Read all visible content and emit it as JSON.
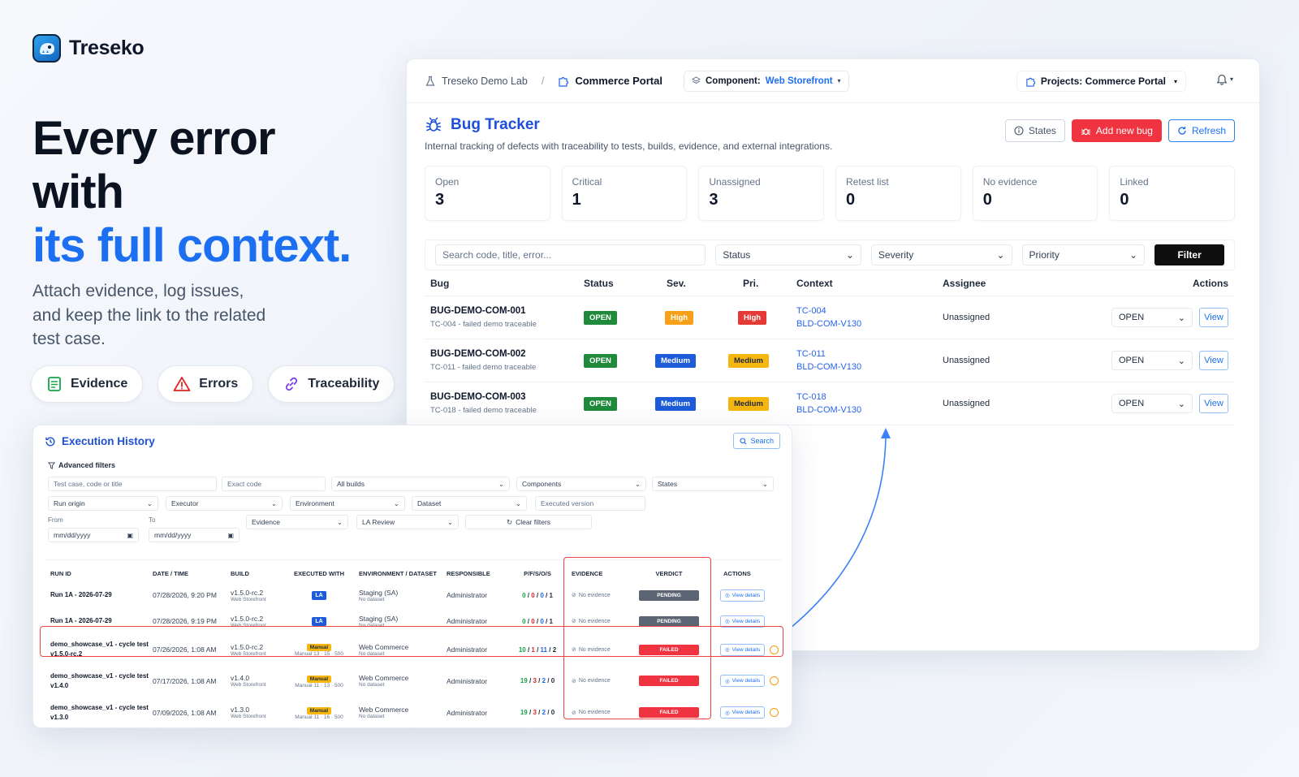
{
  "brand": {
    "name": "Treseko"
  },
  "hero": {
    "line1": "Every error",
    "line2": "with",
    "line3": "its full context.",
    "subtitle": "Attach evidence, log issues, and keep the link to the related test case."
  },
  "chips": [
    {
      "label": "Evidence",
      "icon": "document-icon",
      "color": "#16a34a"
    },
    {
      "label": "Errors",
      "icon": "warning-icon",
      "color": "#dc2626"
    },
    {
      "label": "Traceability",
      "icon": "link-icon",
      "color": "#7c3aed"
    }
  ],
  "colors": {
    "accent": "#1d6ff2",
    "danger": "#ef3340",
    "success": "#1f8a3b",
    "warning": "#f5b70f"
  },
  "bug_tracker": {
    "breadcrumb": {
      "lab": "Treseko Demo Lab",
      "sep": "/",
      "portal": "Commerce Portal"
    },
    "component_label": "Component:",
    "component_value": "Web Storefront",
    "projects_label": "Projects: Commerce Portal",
    "title": "Bug Tracker",
    "description": "Internal tracking of defects with traceability to tests, builds, evidence, and external integrations.",
    "actions": {
      "states": "States",
      "add": "Add new bug",
      "refresh": "Refresh"
    },
    "stats": [
      {
        "label": "Open",
        "value": "3"
      },
      {
        "label": "Critical",
        "value": "1"
      },
      {
        "label": "Unassigned",
        "value": "3"
      },
      {
        "label": "Retest list",
        "value": "0"
      },
      {
        "label": "No evidence",
        "value": "0"
      },
      {
        "label": "Linked",
        "value": "0"
      }
    ],
    "filters": {
      "search_placeholder": "Search code, title, error...",
      "status": "Status",
      "severity": "Severity",
      "priority": "Priority",
      "button": "Filter"
    },
    "columns": {
      "bug": "Bug",
      "status": "Status",
      "sev": "Sev.",
      "pri": "Pri.",
      "context": "Context",
      "assignee": "Assignee",
      "actions": "Actions"
    },
    "rows": [
      {
        "code": "BUG-DEMO-COM-001",
        "sub": "TC-004 - failed demo traceable",
        "status": "OPEN",
        "sev": "High",
        "pri": "High",
        "tc": "TC-004",
        "build": "BLD-COM-V130",
        "assignee": "Unassigned",
        "state": "OPEN",
        "view": "View"
      },
      {
        "code": "BUG-DEMO-COM-002",
        "sub": "TC-011 - failed demo traceable",
        "status": "OPEN",
        "sev": "Medium",
        "pri": "Medium",
        "tc": "TC-011",
        "build": "BLD-COM-V130",
        "assignee": "Unassigned",
        "state": "OPEN",
        "view": "View"
      },
      {
        "code": "BUG-DEMO-COM-003",
        "sub": "TC-018 - failed demo traceable",
        "status": "OPEN",
        "sev": "Medium",
        "pri": "Medium",
        "tc": "TC-018",
        "build": "BLD-COM-V130",
        "assignee": "Unassigned",
        "state": "OPEN",
        "view": "View"
      }
    ]
  },
  "execution_history": {
    "title": "Execution History",
    "search": "Search",
    "advanced": "Advanced filters",
    "filters": {
      "testcase": "Test case, code or title",
      "exact_code": "Exact code",
      "builds": "All builds",
      "components": "Components",
      "states": "States",
      "run_origin": "Run origin",
      "executor": "Executor",
      "environment": "Environment",
      "dataset": "Dataset",
      "executed_version": "Executed version",
      "from_label": "From",
      "to_label": "To",
      "from": "mm/dd/yyyy",
      "to": "mm/dd/yyyy",
      "evidence": "Evidence",
      "la_review": "LA Review",
      "clear": "Clear filters"
    },
    "columns": {
      "run": "RUN ID",
      "date": "DATE / TIME",
      "build": "BUILD",
      "exec": "EXECUTED WITH",
      "env": "ENVIRONMENT / DATASET",
      "resp": "RESPONSIBLE",
      "pfso": "P/F/S/O/S",
      "evi": "EVIDENCE",
      "verdict": "VERDICT",
      "actions": "ACTIONS"
    },
    "rows": [
      {
        "run1": "Run 1A - 2026-07-29",
        "run2": "",
        "date": "07/28/2026, 9:20 PM",
        "build": "v1.5.0-rc.2",
        "build_sub": "Web Storefront",
        "exec": "LA",
        "exec_sub": "",
        "env": "Staging (SA)",
        "env_sub": "No dataset",
        "resp": "Administrator",
        "p": "0",
        "f": "0",
        "s": "0",
        "o": "1",
        "evi": "No evidence",
        "verdict": "PENDING",
        "action": "View details"
      },
      {
        "run1": "Run 1A - 2026-07-29",
        "run2": "",
        "date": "07/28/2026, 9:19 PM",
        "build": "v1.5.0-rc.2",
        "build_sub": "Web Storefront",
        "exec": "LA",
        "exec_sub": "",
        "env": "Staging (SA)",
        "env_sub": "No dataset",
        "resp": "Administrator",
        "p": "0",
        "f": "0",
        "s": "0",
        "o": "1",
        "evi": "No evidence",
        "verdict": "PENDING",
        "action": "View details"
      },
      {
        "run1": "demo_showcase_v1 - cycle test",
        "run2": "v1.5.0-rc.2",
        "date": "07/26/2026, 1:08 AM",
        "build": "v1.5.0-rc.2",
        "build_sub": "Web Storefront",
        "exec": "Manual",
        "exec_sub": "Manual 13 · 15 · 500",
        "env": "Web Commerce",
        "env_sub": "No dataset",
        "resp": "Administrator",
        "p": "10",
        "f": "1",
        "s": "11",
        "o": "2",
        "evi": "No evidence",
        "verdict": "FAILED",
        "action": "View details"
      },
      {
        "run1": "demo_showcase_v1 - cycle test",
        "run2": "v1.4.0",
        "date": "07/17/2026, 1:08 AM",
        "build": "v1.4.0",
        "build_sub": "Web Storefront",
        "exec": "Manual",
        "exec_sub": "Manual 11 · 13 · 500",
        "env": "Web Commerce",
        "env_sub": "No dataset",
        "resp": "Administrator",
        "p": "19",
        "f": "3",
        "s": "2",
        "o": "0",
        "evi": "No evidence",
        "verdict": "FAILED",
        "action": "View details"
      },
      {
        "run1": "demo_showcase_v1 - cycle test",
        "run2": "v1.3.0",
        "date": "07/09/2026, 1:08 AM",
        "build": "v1.3.0",
        "build_sub": "Web Storefront",
        "exec": "Manual",
        "exec_sub": "Manual 11 · 16 · 500",
        "env": "Web Commerce",
        "env_sub": "No dataset",
        "resp": "Administrator",
        "p": "19",
        "f": "3",
        "s": "2",
        "o": "0",
        "evi": "No evidence",
        "verdict": "FAILED",
        "action": "View details"
      }
    ]
  }
}
